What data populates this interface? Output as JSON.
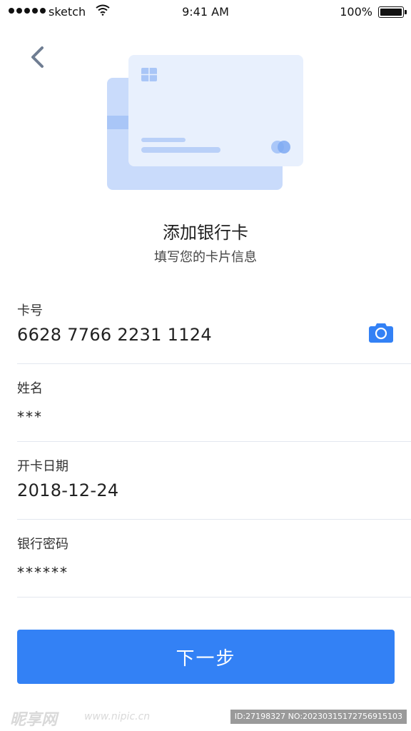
{
  "status_bar": {
    "carrier": "sketch",
    "time": "9:41 AM",
    "battery_percent": "100%"
  },
  "header": {
    "title": "添加银行卡",
    "subtitle": "填写您的卡片信息"
  },
  "form": {
    "fields": [
      {
        "label": "卡号",
        "value": "6628 7766 2231 1124"
      },
      {
        "label": "姓名",
        "value": "***"
      },
      {
        "label": "开卡日期",
        "value": "2018-12-24"
      },
      {
        "label": "银行密码",
        "value": "******"
      }
    ]
  },
  "actions": {
    "next_label": "下一步"
  },
  "watermark": {
    "logo": "昵享网",
    "url": "www.nipic.cn",
    "id_text": "ID:27198327 NO:20230315172756915103"
  },
  "colors": {
    "primary": "#3381f5",
    "card_light": "#e8f0fd",
    "card_back": "#c9dbfb",
    "divider": "#e3e7ef"
  },
  "icons": {
    "back": "chevron-left-icon",
    "camera": "camera-icon"
  }
}
